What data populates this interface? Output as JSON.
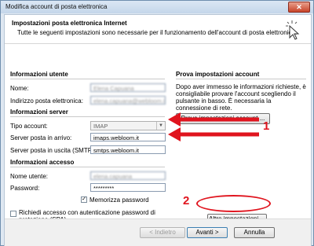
{
  "window": {
    "title": "Modifica account di posta elettronica",
    "close_symbol": "✕"
  },
  "header": {
    "title": "Impostazioni posta elettronica Internet",
    "subtitle": "Tutte le seguenti impostazioni sono necessarie per il funzionamento dell'account di posta elettronica."
  },
  "user_info": {
    "section_title": "Informazioni utente",
    "name_label": "Nome:",
    "name_value": "Elena Capuana",
    "email_label": "Indirizzo posta elettronica:",
    "email_value": "elena.capuana@webloom.it"
  },
  "server_info": {
    "section_title": "Informazioni server",
    "account_type_label": "Tipo account:",
    "account_type_value": "IMAP",
    "incoming_label": "Server posta in arrivo:",
    "incoming_value": "imaps.webloom.it",
    "outgoing_label": "Server posta in uscita (SMTP):",
    "outgoing_value": "smtps.webloom.it"
  },
  "access_info": {
    "section_title": "Informazioni accesso",
    "username_label": "Nome utente:",
    "username_value": "elena.capuana",
    "password_label": "Password:",
    "password_value": "*********",
    "remember_label": "Memorizza password",
    "remember_checked": true,
    "spa_label": "Richiedi accesso con autenticazione password di protezione (SPA)",
    "spa_checked": false
  },
  "test": {
    "section_title": "Prova impostazioni account",
    "description": "Dopo aver immesso le informazioni richieste, è consigliabile provare l'account scegliendo il pulsante in basso. È necessaria la connessione di rete.",
    "button_label": "Prova impostazioni account ...",
    "more_settings_label": "Altre impostazioni ..."
  },
  "footer": {
    "back_label": "< Indietro",
    "next_label": "Avanti >",
    "cancel_label": "Annulla"
  },
  "annotations": {
    "marker_1": "1",
    "marker_2": "2",
    "color": "#e0141e"
  },
  "check_symbol": "✓"
}
